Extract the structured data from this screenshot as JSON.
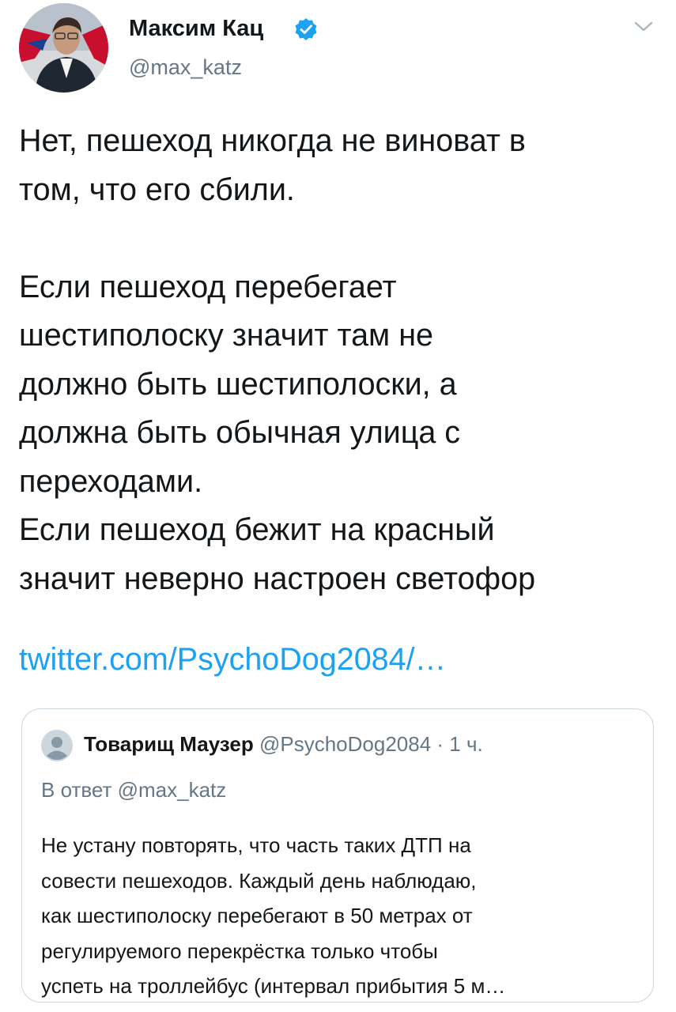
{
  "author": {
    "name": "Максим Кац",
    "handle": "@max_katz",
    "verified": true
  },
  "icons": {
    "avatar": "profile-photo",
    "verified": "verified-badge-icon",
    "menu": "chevron-down-icon",
    "quote_avatar": "default-avatar-icon"
  },
  "tweet": {
    "text": "Нет, пешеход никогда не виноват в\nтом, что его сбили.\n\nЕсли пешеход перебегает\nшестиполоску значит там не\nдолжно быть шестиполоски, а\nдолжна быть обычная улица с\nпереходами.\nЕсли пешеход бежит на красный\nзначит неверно настроен светофор",
    "link": "twitter.com/PsychoDog2084/…"
  },
  "quote": {
    "name": "Товарищ Маузер",
    "meta": "@PsychoDog2084 · 1 ч.",
    "reply_to": "В ответ @max_katz",
    "text": "Не устану повторять, что часть таких ДТП на\nсовести пешеходов. Каждый день наблюдаю,\nкак шестиполоску перебегают в 50 метрах от\nрегулируемого перекрёстка только чтобы\nуспеть на троллейбус (интервал прибытия 5 м…"
  },
  "colors": {
    "text": "#14171a",
    "secondary": "#657786",
    "link": "#1da1f2",
    "border": "#ccd6dd"
  }
}
